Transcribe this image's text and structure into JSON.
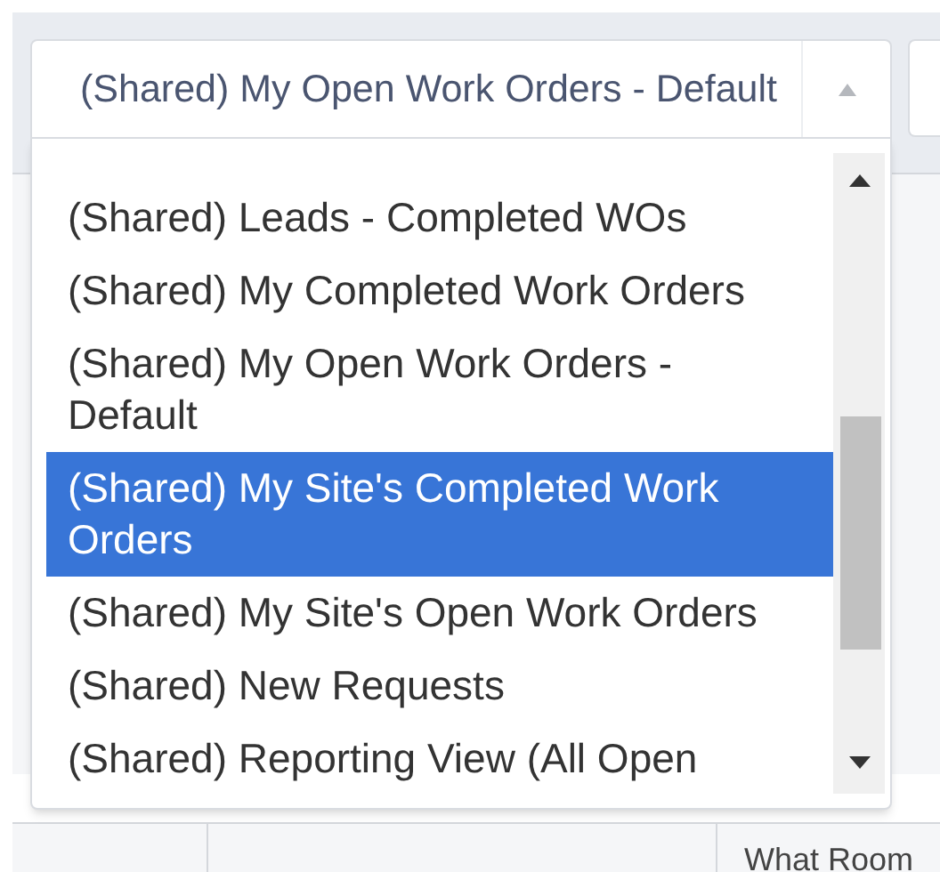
{
  "select": {
    "value": "(Shared) My Open Work Orders - Default",
    "expanded": true
  },
  "options": [
    {
      "label": "(Shared) Leads - Completed WOs",
      "selected": false
    },
    {
      "label": "(Shared) My Completed Work Orders",
      "selected": false
    },
    {
      "label": "(Shared) My Open Work Orders - Default",
      "selected": false
    },
    {
      "label": "(Shared) My Site's Completed Work Orders",
      "selected": true
    },
    {
      "label": "(Shared) My Site's Open Work Orders",
      "selected": false
    },
    {
      "label": "(Shared) New Requests",
      "selected": false
    },
    {
      "label": "(Shared) Reporting View (All Open",
      "selected": false
    }
  ],
  "table": {
    "columns": [
      "What Room"
    ]
  }
}
